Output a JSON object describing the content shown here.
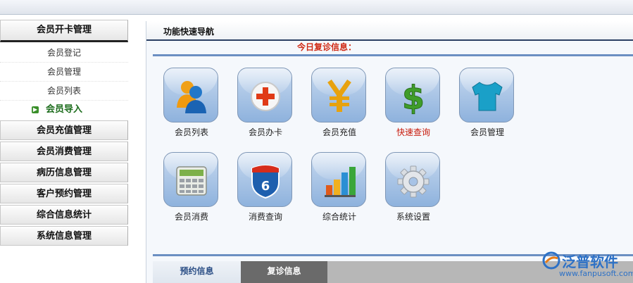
{
  "sidebar": {
    "groups": [
      {
        "label": "会员开卡管理"
      },
      {
        "label": "会员充值管理"
      },
      {
        "label": "会员消费管理"
      },
      {
        "label": "病历信息管理"
      },
      {
        "label": "客户预约管理"
      },
      {
        "label": "综合信息统计"
      },
      {
        "label": "系统信息管理"
      }
    ],
    "sub_items": [
      {
        "label": "会员登记"
      },
      {
        "label": "会员管理"
      },
      {
        "label": "会员列表"
      },
      {
        "label": "会员导入"
      }
    ],
    "active_sub_item": "会员导入"
  },
  "main": {
    "title": "功能快速导航",
    "notice": "今日复诊信息：",
    "shortcuts": [
      {
        "label": "会员列表",
        "icon": "users-icon"
      },
      {
        "label": "会员办卡",
        "icon": "plus-icon"
      },
      {
        "label": "会员充值",
        "icon": "yen-icon"
      },
      {
        "label": "快速查询",
        "icon": "dollar-icon",
        "highlight": "#c81b0c"
      },
      {
        "label": "会员管理",
        "icon": "tshirt-icon"
      },
      {
        "label": "会员消费",
        "icon": "calculator-icon"
      },
      {
        "label": "消费查询",
        "icon": "route-shield-icon"
      },
      {
        "label": "综合统计",
        "icon": "bar-chart-icon"
      },
      {
        "label": "系统设置",
        "icon": "gear-icon"
      }
    ],
    "tabs": [
      {
        "label": "预约信息"
      },
      {
        "label": "复诊信息"
      }
    ]
  },
  "watermark": {
    "brand": "泛普软件",
    "url": "www.fanpusoft.com"
  },
  "colors": {
    "accent_red": "#d02a15",
    "rule_blue": "#6b8fc2",
    "active_green": "#1a6b1a",
    "brand_blue": "#2d71c6"
  }
}
